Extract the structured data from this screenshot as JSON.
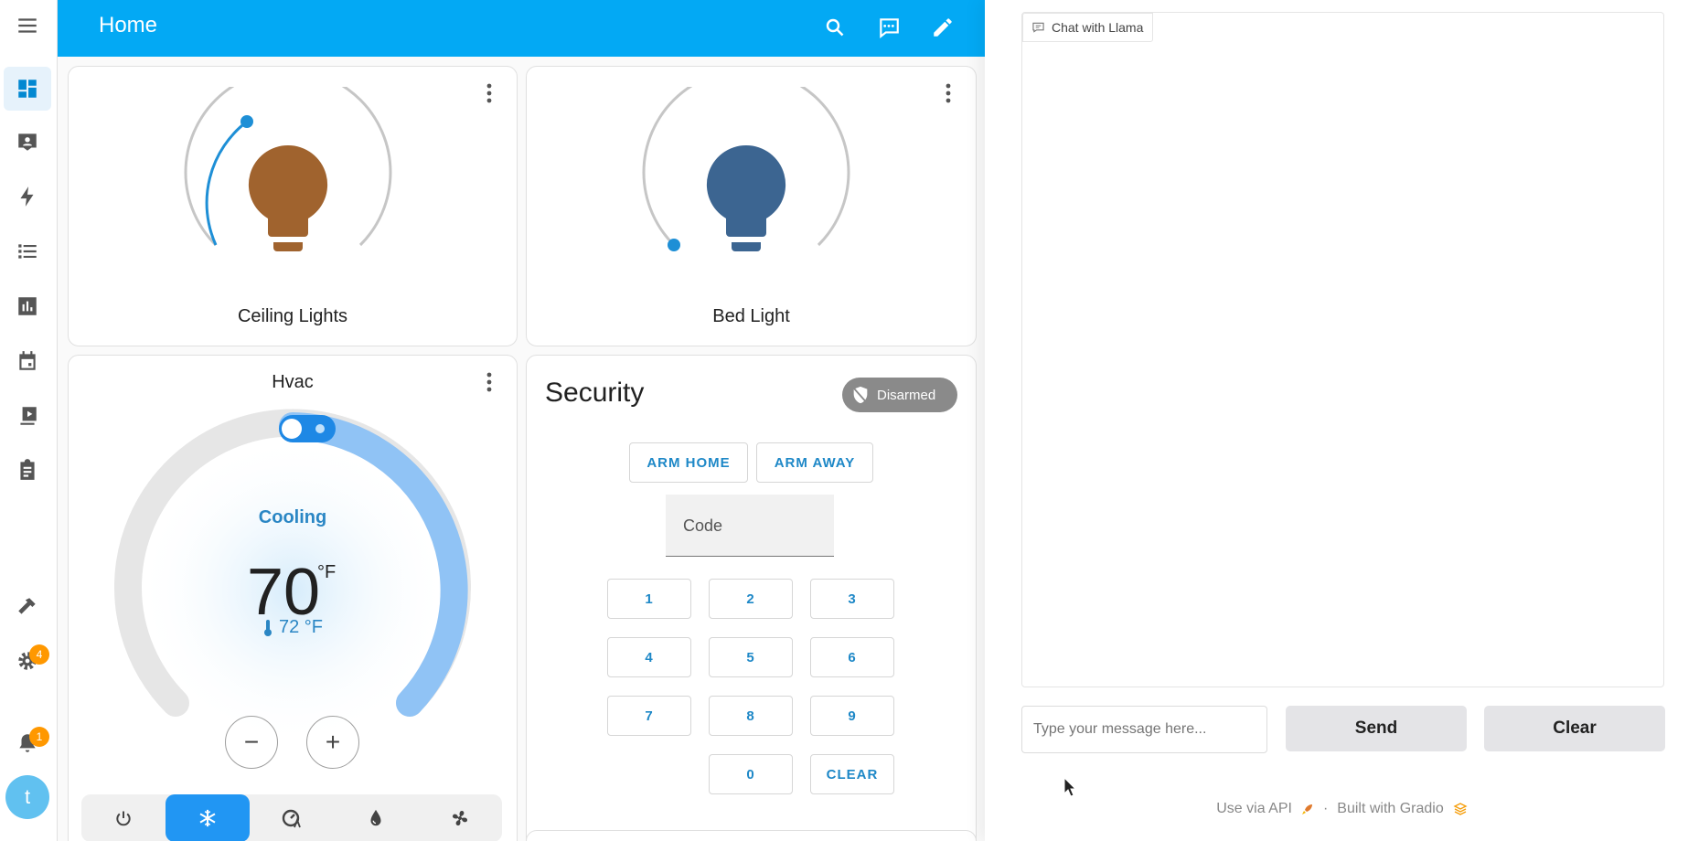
{
  "header": {
    "title": "Home"
  },
  "cards": {
    "ceiling": {
      "name": "Ceiling Lights",
      "color": "#a0632e"
    },
    "bed": {
      "name": "Bed Light",
      "color": "#3c6591"
    },
    "hvac": {
      "name": "Hvac",
      "status": "Cooling",
      "target": "70",
      "unit": "°F",
      "current": "72 °F",
      "decrease": "−",
      "increase": "+"
    }
  },
  "security": {
    "title": "Security",
    "state": "Disarmed",
    "arm_home": "ARM HOME",
    "arm_away": "ARM AWAY",
    "code_label": "Code",
    "keys": [
      "1",
      "2",
      "3",
      "4",
      "5",
      "6",
      "7",
      "8",
      "9",
      "0"
    ],
    "clear_key": "CLEAR"
  },
  "sidebar": {
    "settings_badge": "4",
    "notifications_badge": "1",
    "user_initial": "t"
  },
  "gradio": {
    "chat_label": "Chat with Llama",
    "input_placeholder": "Type your message here...",
    "send": "Send",
    "clear": "Clear",
    "footer_api": "Use via API",
    "footer_sep": "·",
    "footer_built": "Built with Gradio"
  },
  "colors": {
    "accent": "#03a9f4",
    "active_mode": "#2196f3",
    "link": "#1e88c7"
  }
}
